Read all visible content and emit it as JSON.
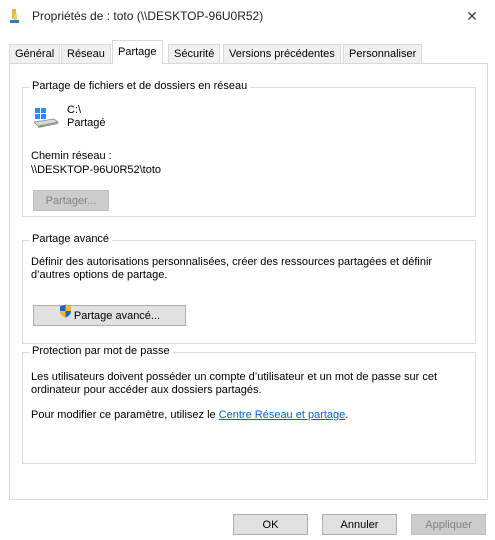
{
  "window": {
    "title": "Propriétés de : toto (\\\\DESKTOP-96U0R52)",
    "close_symbol": "✕"
  },
  "tabs": [
    {
      "label": "Général"
    },
    {
      "label": "Réseau"
    },
    {
      "label": "Partage",
      "active": true
    },
    {
      "label": "Sécurité"
    },
    {
      "label": "Versions précédentes"
    },
    {
      "label": "Personnaliser"
    }
  ],
  "file_sharing": {
    "group_label": "Partage de fichiers et de dossiers en réseau",
    "drive_path": "C:\\",
    "status": "Partagé",
    "network_path_label": "Chemin réseau :",
    "network_path": "\\\\DESKTOP-96U0R52\\toto",
    "share_button": "Partager..."
  },
  "advanced_sharing": {
    "group_label": "Partage avancé",
    "description": "Définir des autorisations personnalisées, créer des ressources partagées et définir d’autres options de partage.",
    "button": "Partage avancé..."
  },
  "password_protection": {
    "group_label": "Protection par mot de passe",
    "description": "Les utilisateurs doivent posséder un compte d’utilisateur et un mot de passe sur cet ordinateur pour accéder aux dossiers partagés.",
    "change_prefix": "Pour modifier ce paramètre, utilisez le ",
    "link_text": "Centre Réseau et partage",
    "change_suffix": "."
  },
  "footer": {
    "ok": "OK",
    "cancel": "Annuler",
    "apply": "Appliquer"
  },
  "colors": {
    "link": "#0066cc",
    "accent": "#0078d7"
  },
  "icons": [
    "folder-icon",
    "close-icon",
    "network-drive-icon",
    "uac-shield-icon"
  ]
}
